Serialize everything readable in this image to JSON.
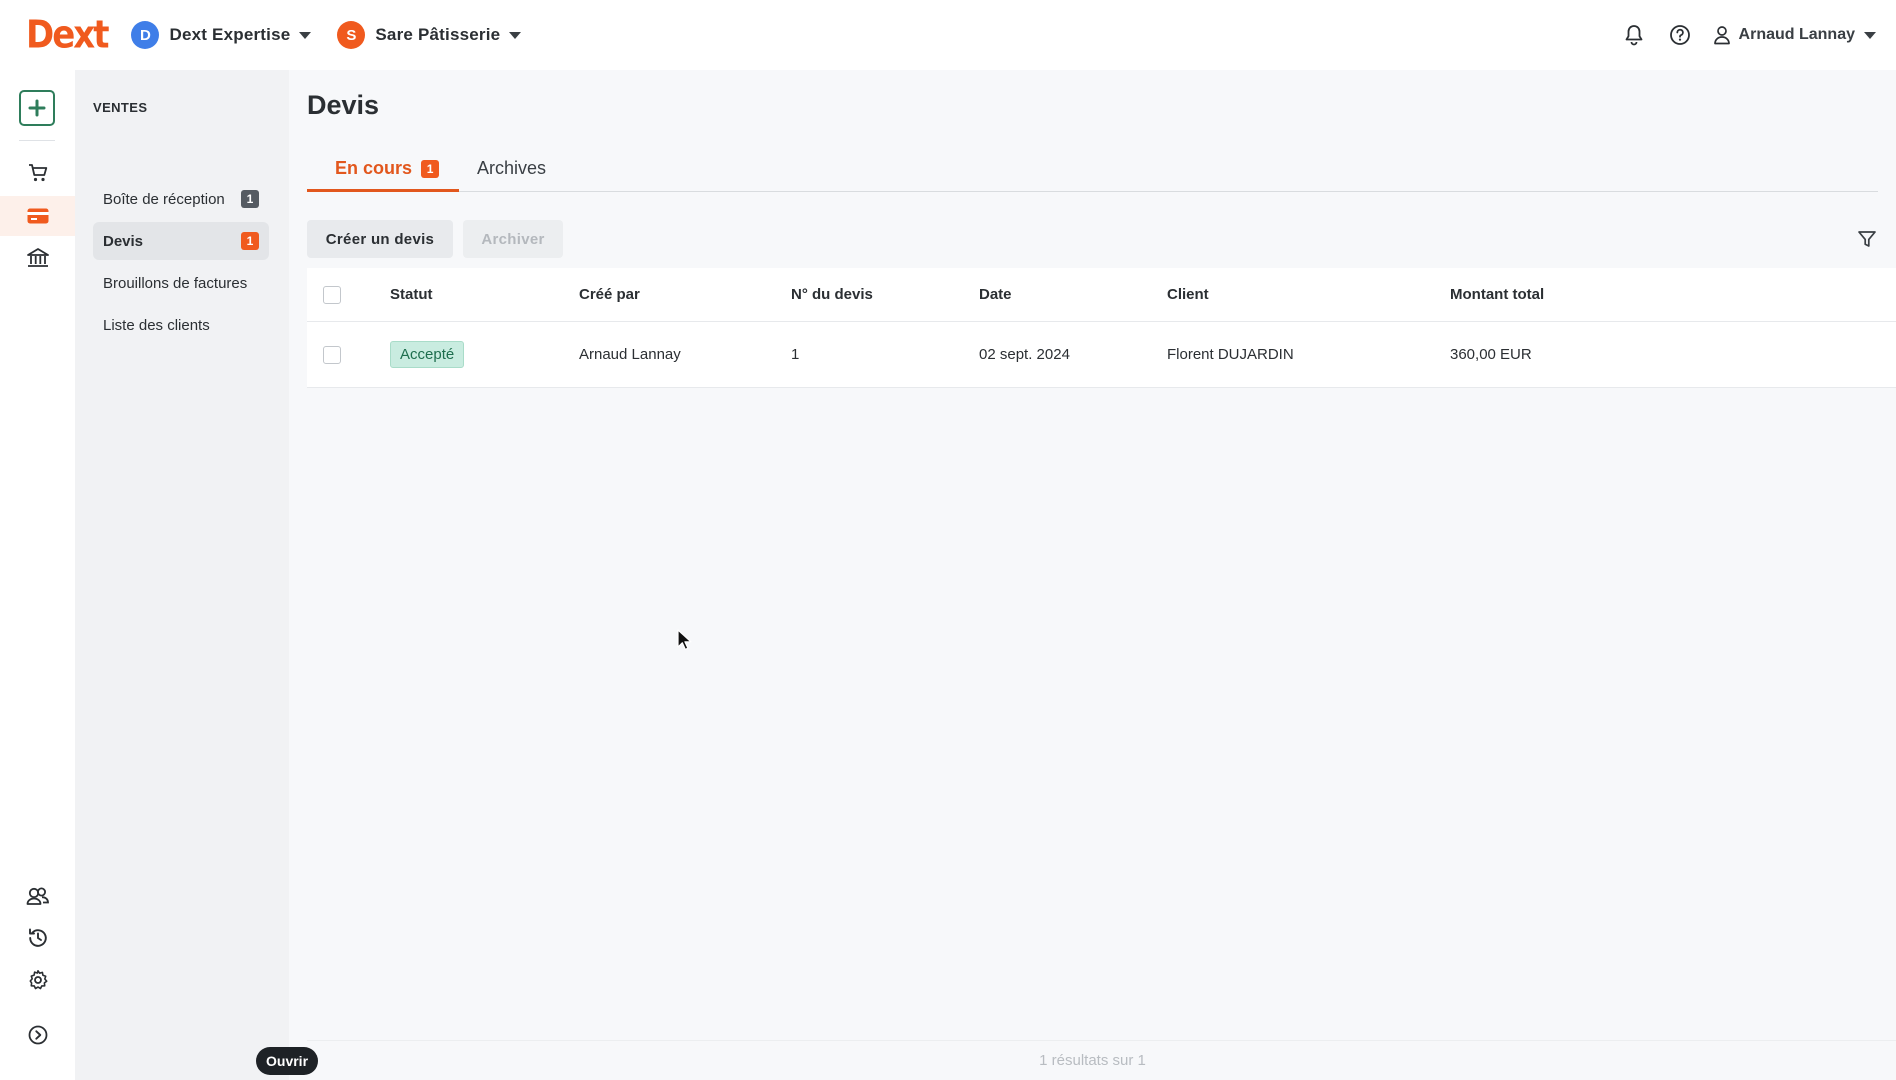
{
  "brand": {
    "logo_text": "Dext",
    "accent_color": "#f05a1e"
  },
  "header": {
    "orgs": [
      {
        "initial": "D",
        "name": "Dext Expertise",
        "color": "#3f7ee8"
      },
      {
        "initial": "S",
        "name": "Sare Pâtisserie",
        "color": "#f05a1e"
      }
    ],
    "user_name": "Arnaud Lannay",
    "icons": [
      "bell-icon",
      "help-icon",
      "user-icon"
    ]
  },
  "rail": {
    "items": [
      "add-icon",
      "cart-icon",
      "card-icon",
      "bank-icon",
      "contacts-icon",
      "history-icon",
      "gear-icon",
      "expand-icon"
    ],
    "active": "card-icon"
  },
  "subnav": {
    "section_title": "VENTES",
    "items": [
      {
        "label": "Boîte de réception",
        "badge": "1"
      },
      {
        "label": "Devis",
        "badge": "1"
      },
      {
        "label": "Brouillons de factures"
      },
      {
        "label": "Liste des clients"
      }
    ]
  },
  "main": {
    "title": "Devis",
    "tabs": [
      {
        "label": "En cours",
        "badge": "1"
      },
      {
        "label": "Archives"
      }
    ],
    "buttons": {
      "create": "Créer un devis",
      "archive": "Archiver"
    },
    "table": {
      "columns": [
        "Statut",
        "Créé par",
        "N° du devis",
        "Date",
        "Client",
        "Montant total"
      ],
      "rows": [
        {
          "status": "Accepté",
          "created_by": "Arnaud Lannay",
          "number": "1",
          "date": "02 sept. 2024",
          "client": "Florent DUJARDIN",
          "amount": "360,00 EUR"
        }
      ]
    },
    "results": "1 résultats sur 1"
  },
  "tooltip": "Ouvrir"
}
